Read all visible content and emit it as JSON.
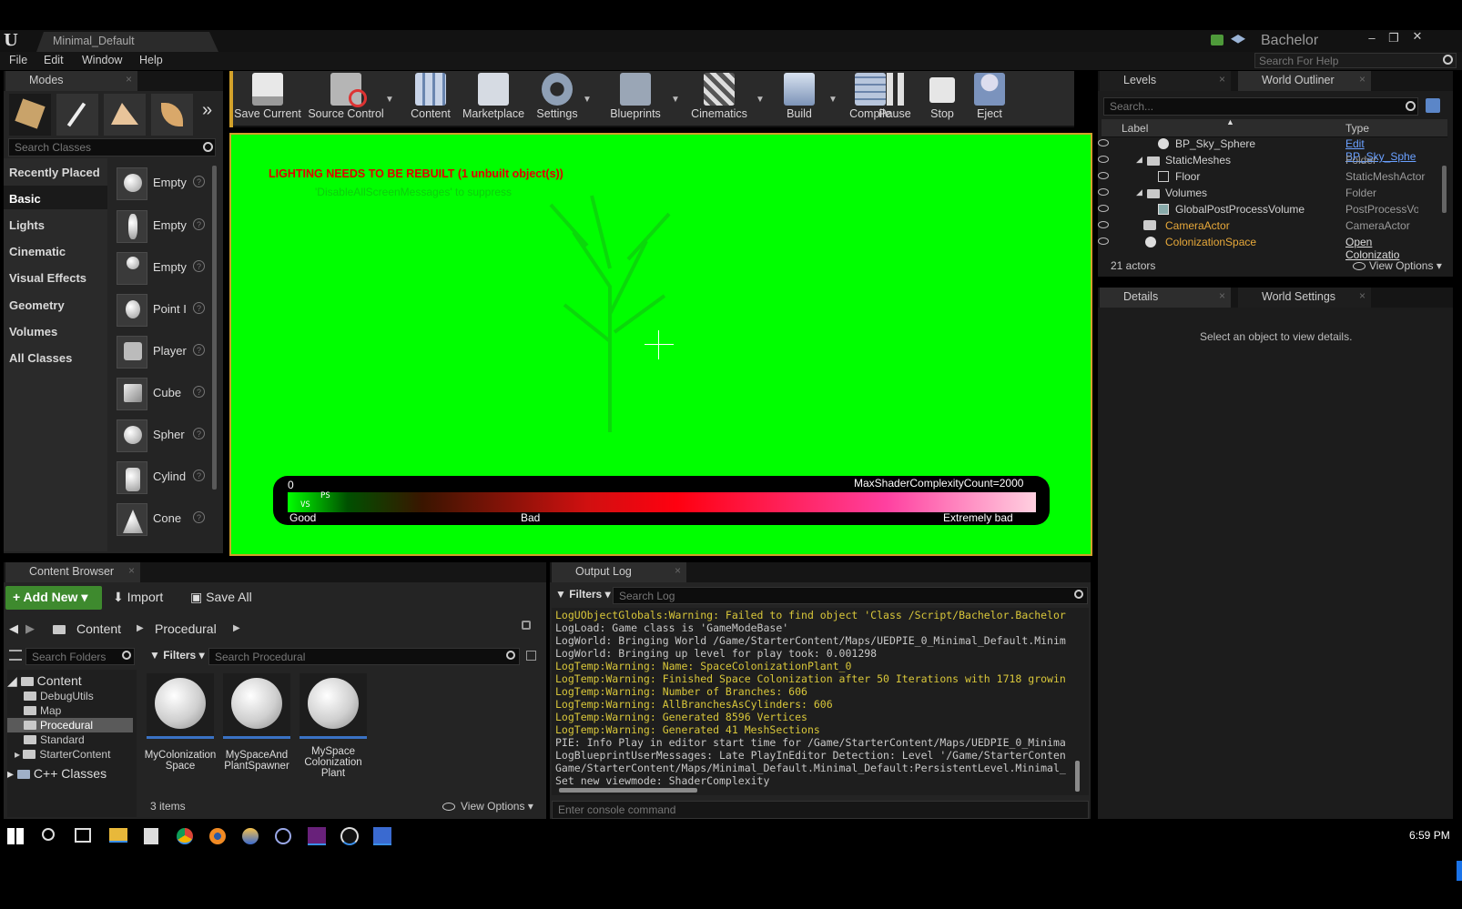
{
  "window": {
    "title": "Minimal_Default",
    "project": "Bachelor",
    "help_search_placeholder": "Search For Help"
  },
  "menu": [
    "File",
    "Edit",
    "Window",
    "Help"
  ],
  "modes": {
    "tab": "Modes",
    "search_placeholder": "Search Classes",
    "categories": [
      "Recently Placed",
      "Basic",
      "Lights",
      "Cinematic",
      "Visual Effects",
      "Geometry",
      "Volumes",
      "All Classes"
    ],
    "selected_category": "Basic",
    "items": [
      "Empty",
      "Empty",
      "Empty",
      "Point I",
      "Player",
      "Cube",
      "Spher",
      "Cylind",
      "Cone"
    ]
  },
  "toolbar": [
    "Save Current",
    "Source Control",
    "Content",
    "Marketplace",
    "Settings",
    "Blueprints",
    "Cinematics",
    "Build",
    "Compile",
    "Pause",
    "Stop",
    "Eject"
  ],
  "viewport": {
    "warning": "LIGHTING NEEDS TO BE REBUILT (1 unbuilt object(s))",
    "hint": "'DisableAllScreenMessages' to suppress",
    "bar_min": "0",
    "bar_max": "MaxShaderComplexityCount=2000",
    "bar_ps": "PS",
    "bar_vs": "VS",
    "good": "Good",
    "bad": "Bad",
    "extremely_bad": "Extremely bad",
    "colors": {
      "background": "#00ff00",
      "warning": "#e00000"
    }
  },
  "levels_tab": "Levels",
  "outliner": {
    "tab": "World Outliner",
    "search_placeholder": "Search...",
    "col_label": "Label",
    "col_type": "Type",
    "rows": [
      {
        "label": "BP_Sky_Sphere",
        "type": "Edit BP_Sky_Sphe"
      },
      {
        "label": "StaticMeshes",
        "type": "Folder"
      },
      {
        "label": "Floor",
        "type": "StaticMeshActor"
      },
      {
        "label": "Volumes",
        "type": "Folder"
      },
      {
        "label": "GlobalPostProcessVolume",
        "type": "PostProcessVolum"
      },
      {
        "label": "CameraActor",
        "type": "CameraActor"
      },
      {
        "label": "ColonizationSpace",
        "type": "Open Colonizatio"
      }
    ],
    "count": "21 actors",
    "view_options": "View Options"
  },
  "details": {
    "tab": "Details",
    "world_settings_tab": "World Settings",
    "empty": "Select an object to view details."
  },
  "content_browser": {
    "tab": "Content Browser",
    "add_new": "Add New",
    "import": "Import",
    "save_all": "Save All",
    "path": [
      "Content",
      "Procedural"
    ],
    "search_folders": "Search Folders",
    "filters": "Filters",
    "search_assets": "Search Procedural",
    "tree": [
      "Content",
      "DebugUtils",
      "Map",
      "Procedural",
      "Standard",
      "StarterContent",
      "C++ Classes"
    ],
    "assets": [
      {
        "name": "MyColonization\nSpace"
      },
      {
        "name": "MySpaceAnd\nPlantSpawner"
      },
      {
        "name": "MySpace\nColonization\nPlant"
      }
    ],
    "count": "3 items",
    "view_options": "View Options"
  },
  "output_log": {
    "tab": "Output Log",
    "filters": "Filters",
    "search_placeholder": "Search Log",
    "console_placeholder": "Enter console command",
    "lines": [
      {
        "t": "LogUObjectGlobals:Warning: Failed to find object 'Class /Script/Bachelor.Bachelor",
        "w": true
      },
      {
        "t": "LogLoad: Game class is 'GameModeBase'",
        "w": false
      },
      {
        "t": "LogWorld: Bringing World /Game/StarterContent/Maps/UEDPIE_0_Minimal_Default.Minim",
        "w": false
      },
      {
        "t": "LogWorld: Bringing up level for play took: 0.001298",
        "w": false
      },
      {
        "t": "LogTemp:Warning: Name: SpaceColonizationPlant_0",
        "w": true
      },
      {
        "t": "LogTemp:Warning: Finished Space Colonization after 50 Iterations with 1718 growin",
        "w": true
      },
      {
        "t": "LogTemp:Warning: Number of Branches: 606",
        "w": true
      },
      {
        "t": "LogTemp:Warning: AllBranchesAsCylinders: 606",
        "w": true
      },
      {
        "t": "LogTemp:Warning: Generated 8596 Vertices",
        "w": true
      },
      {
        "t": "LogTemp:Warning: Generated 41 MeshSections",
        "w": true
      },
      {
        "t": "PIE: Info Play in editor start time for /Game/StarterContent/Maps/UEDPIE_0_Minima",
        "w": false
      },
      {
        "t": "LogBlueprintUserMessages: Late PlayInEditor Detection: Level '/Game/StarterConten",
        "w": false
      },
      {
        "t": "Game/StarterContent/Maps/Minimal_Default.Minimal_Default:PersistentLevel.Minimal_",
        "w": false
      },
      {
        "t": "Set new viewmode: ShaderComplexity",
        "w": false
      }
    ]
  },
  "taskbar": {
    "time": "6:59 PM"
  }
}
